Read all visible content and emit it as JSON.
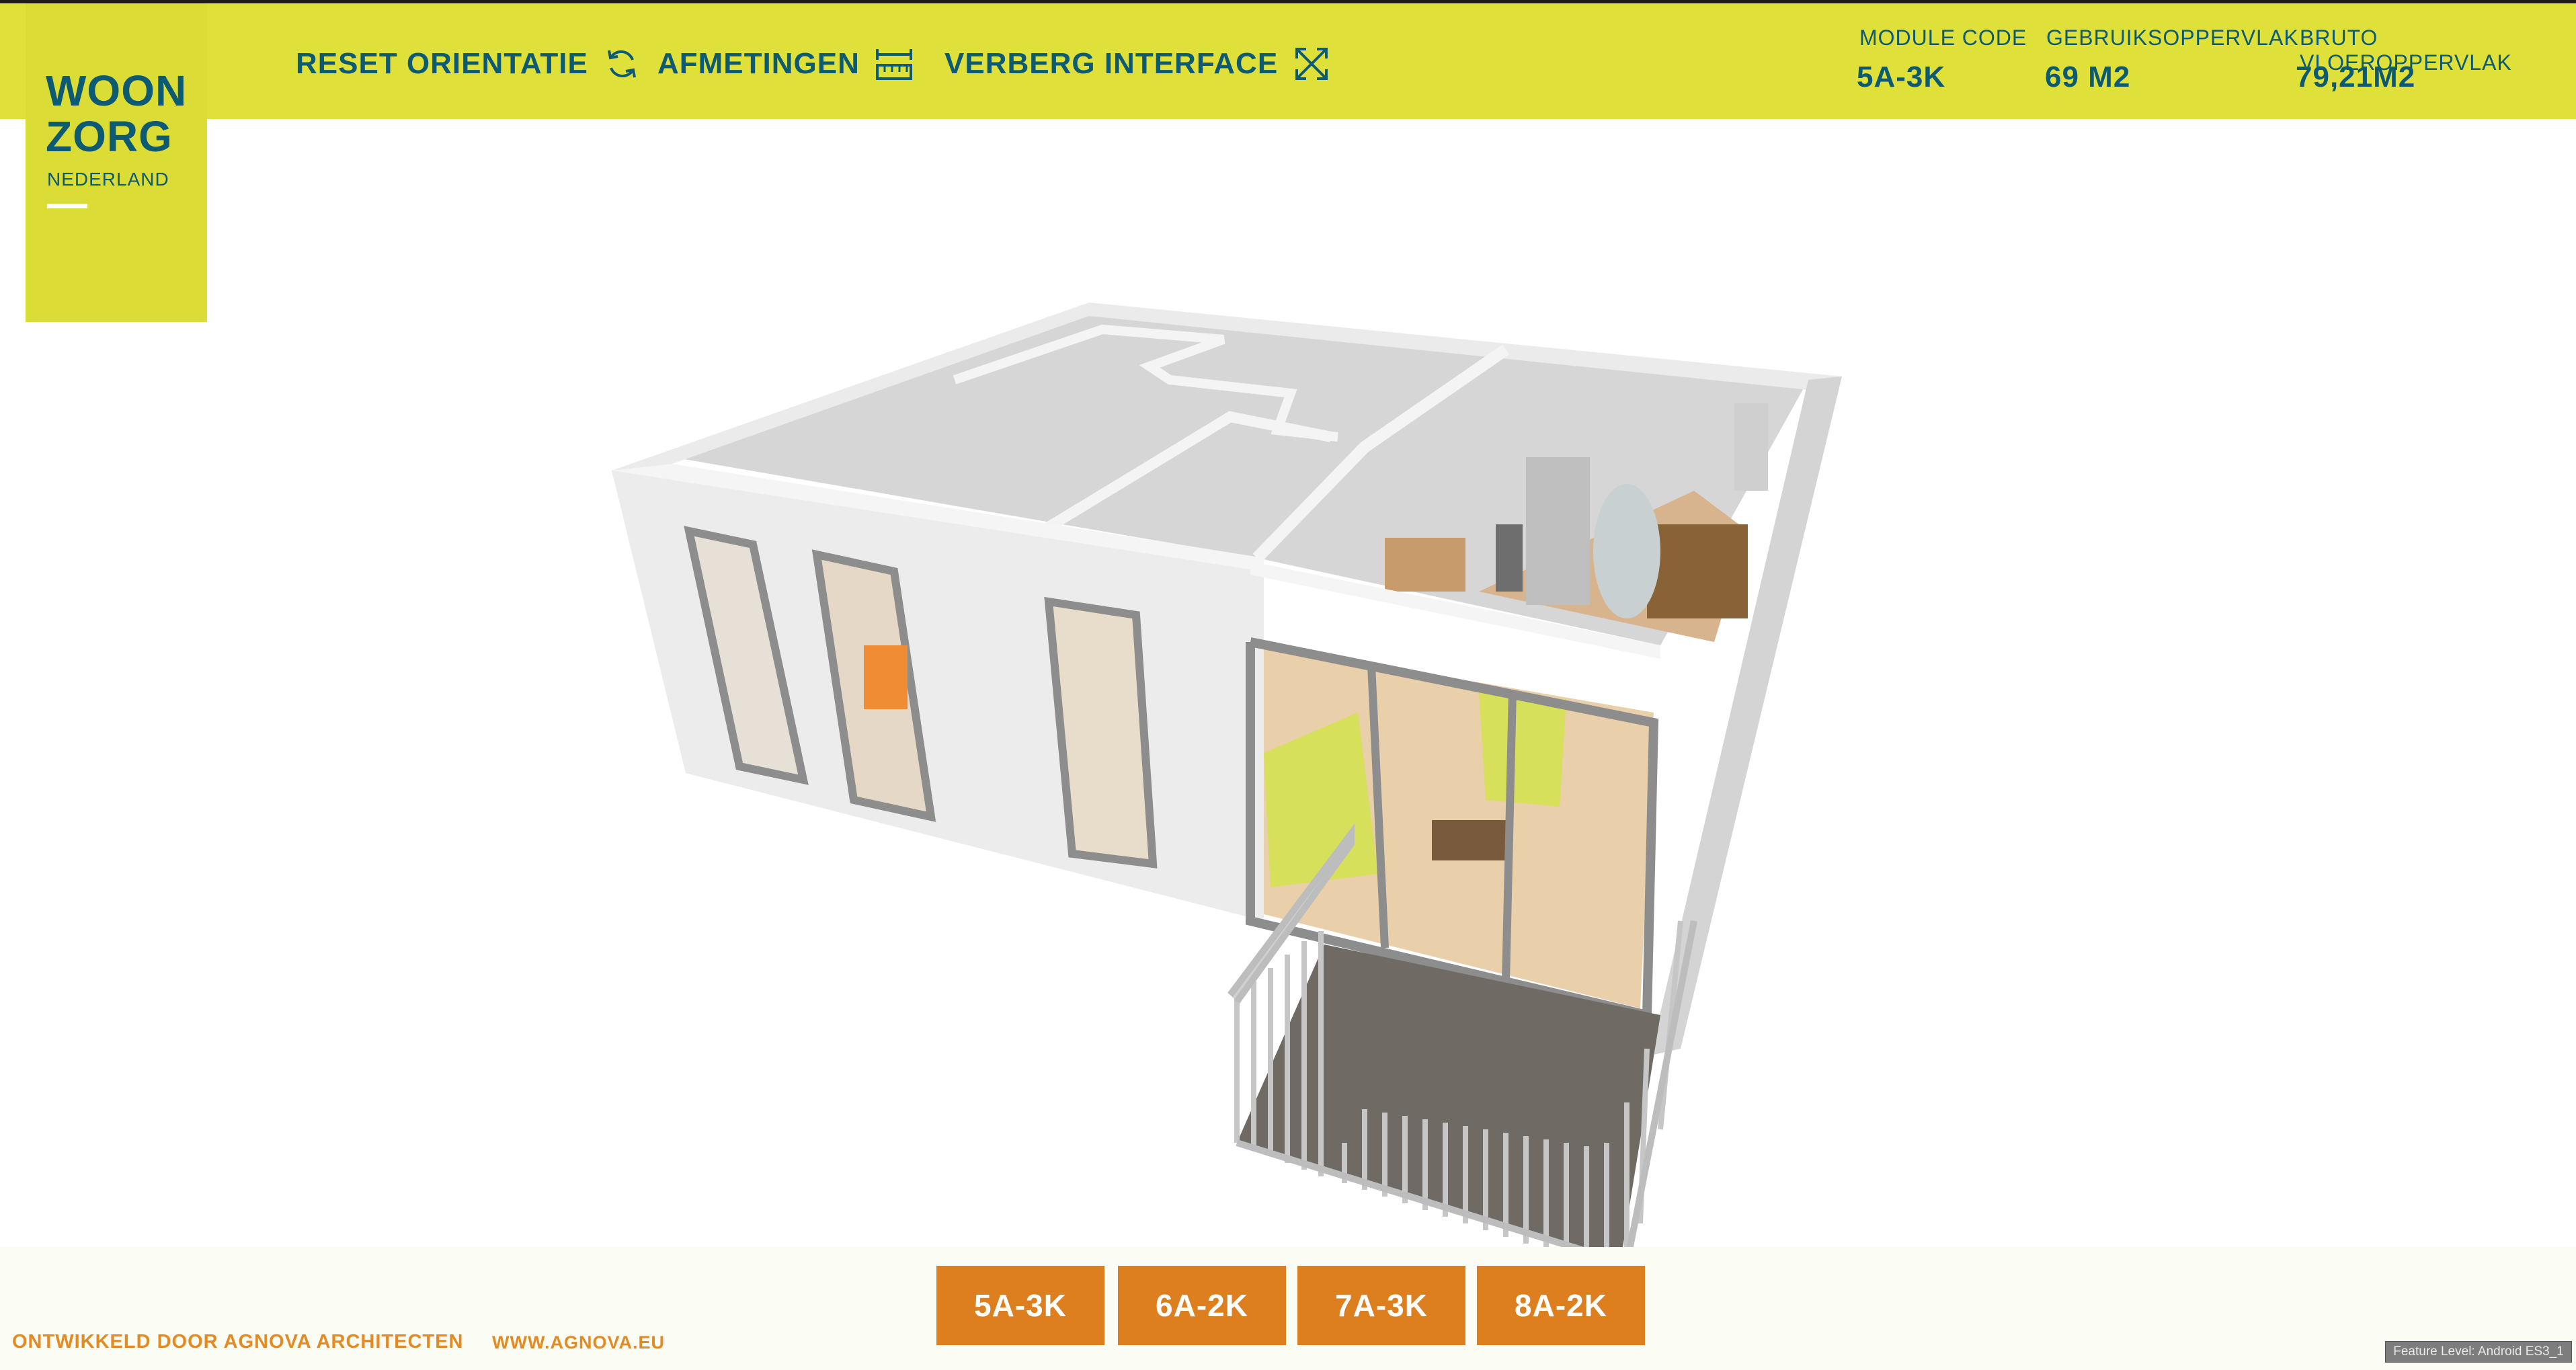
{
  "brand": {
    "line1": "WOON",
    "line2": "ZORG",
    "subtitle": "NEDERLAND"
  },
  "nav": {
    "reset_label": "RESET ORIENTATIE",
    "measure_label": "AFMETINGEN",
    "hide_label": "VERBERG INTERFACE"
  },
  "stats": {
    "module_code_label": "MODULE CODE",
    "module_code_value": "5A-3K",
    "usable_area_label": "GEBRUIKSOPPERVLAK",
    "usable_area_value": "69 M2",
    "gross_area_label": "BRUTO VLOEROPPERVLAK",
    "gross_area_value": "79,21M2"
  },
  "modules": [
    "5A-3K",
    "6A-2K",
    "7A-3K",
    "8A-2K"
  ],
  "footer": {
    "credit": "ONTWIKKELD DOOR AGNOVA ARCHITECTEN",
    "url": "WWW.AGNOVA.EU",
    "feature_level": "Feature Level: Android ES3_1"
  },
  "colors": {
    "accent_yellow": "#dfe03a",
    "text_blue": "#0d5a73",
    "button_orange": "#dd7f1e"
  },
  "icons": {
    "reset": "refresh-icon",
    "measure": "ruler-icon",
    "hide": "fullscreen-arrows-icon"
  }
}
